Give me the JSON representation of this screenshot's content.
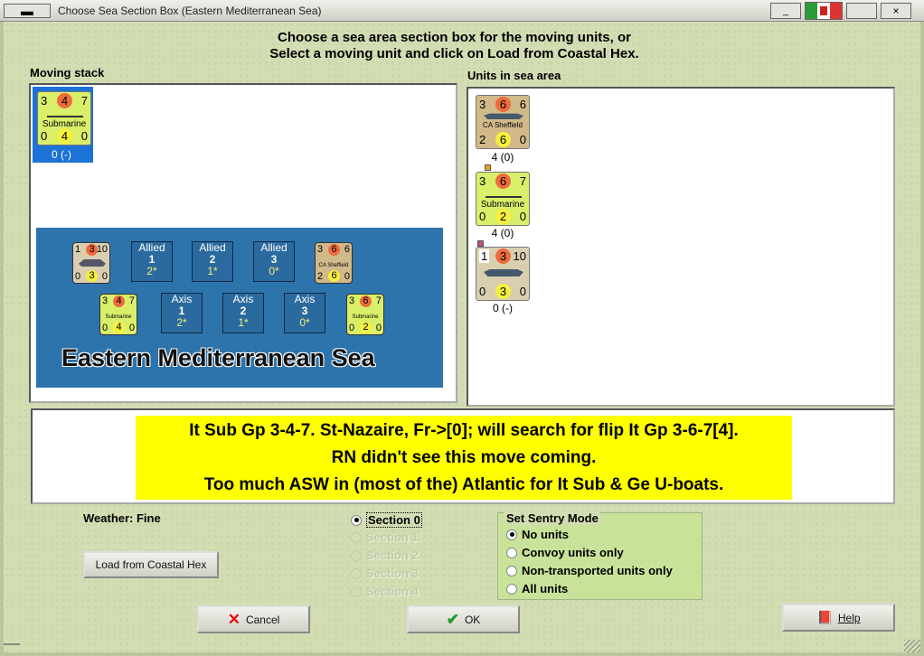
{
  "window": {
    "title": "Choose Sea Section Box (Eastern Mediterranean Sea)",
    "sys_icon": "▬",
    "close_label": "×",
    "min_label": "_"
  },
  "instructions": {
    "line1": "Choose a sea area section box for the moving units, or",
    "line2": "Select a moving unit and click on Load from Coastal Hex."
  },
  "moving_stack": {
    "label": "Moving stack",
    "unit": {
      "tl": "3",
      "tc": "4",
      "tr": "7",
      "name": "Submarine",
      "bl": "0",
      "bc": "4",
      "br": "0",
      "caption": "0 (-)"
    }
  },
  "units_in_sea": {
    "label": "Units in sea area",
    "units": [
      {
        "tl": "3",
        "tc": "6",
        "tr": "6",
        "name": "CA Sheffield",
        "bl": "2",
        "bc": "6",
        "br": "0",
        "caption": "4 (0)"
      },
      {
        "tl": "3",
        "tc": "6",
        "tr": "7",
        "name": "Submarine",
        "bl": "0",
        "bc": "2",
        "br": "0",
        "caption": "4 (0)"
      },
      {
        "tl": "1",
        "tc": "3",
        "tr": "10",
        "name": "",
        "bl": "0",
        "bc": "3",
        "br": "0",
        "caption": "0 (-)"
      }
    ]
  },
  "sea_map": {
    "name": "Eastern Mediterranean Sea",
    "allied_boxes": [
      {
        "side": "Allied",
        "num": "1",
        "val": "2*"
      },
      {
        "side": "Allied",
        "num": "2",
        "val": "1*"
      },
      {
        "side": "Allied",
        "num": "3",
        "val": "0*"
      }
    ],
    "axis_boxes": [
      {
        "side": "Axis",
        "num": "1",
        "val": "2*"
      },
      {
        "side": "Axis",
        "num": "2",
        "val": "1*"
      },
      {
        "side": "Axis",
        "num": "3",
        "val": "0*"
      }
    ],
    "counters": [
      {
        "tl": "1",
        "tc": "3",
        "tr": "10",
        "name": "",
        "bl": "0",
        "bc": "3",
        "br": "0"
      },
      {
        "tl": "3",
        "tc": "6",
        "tr": "6",
        "name": "CA Sheffield",
        "bl": "2",
        "bc": "6",
        "br": "0"
      },
      {
        "tl": "3",
        "tc": "4",
        "tr": "7",
        "name": "Submarine",
        "bl": "0",
        "bc": "4",
        "br": "0"
      },
      {
        "tl": "3",
        "tc": "6",
        "tr": "7",
        "name": "Submarine",
        "bl": "0",
        "bc": "2",
        "br": "0"
      }
    ]
  },
  "notes": {
    "line1": "It Sub Gp 3-4-7.  St-Nazaire, Fr->[0]; will search for flip It Gp 3-6-7[4].",
    "line2": "RN didn't see this move coming.",
    "line3": "Too much ASW in (most of the) Atlantic for It Sub & Ge U-boats."
  },
  "weather": "Weather: Fine",
  "sections": [
    "Section 0",
    "Section 1",
    "Section 2",
    "Section 3",
    "Section 4"
  ],
  "sentry": {
    "title": "Set Sentry Mode",
    "options": [
      "No units",
      "Convoy units only",
      "Non-transported units only",
      "All units"
    ]
  },
  "buttons": {
    "load": "Load from Coastal Hex",
    "cancel": "Cancel",
    "ok": "OK",
    "help": "Help"
  },
  "colors": {
    "sub_counter": "#d9ef6a",
    "ca_counter": "#d2b98a",
    "uk_counter": "#d9cfb0",
    "sea": "#2d74ac",
    "selection": "#1c72d6"
  }
}
